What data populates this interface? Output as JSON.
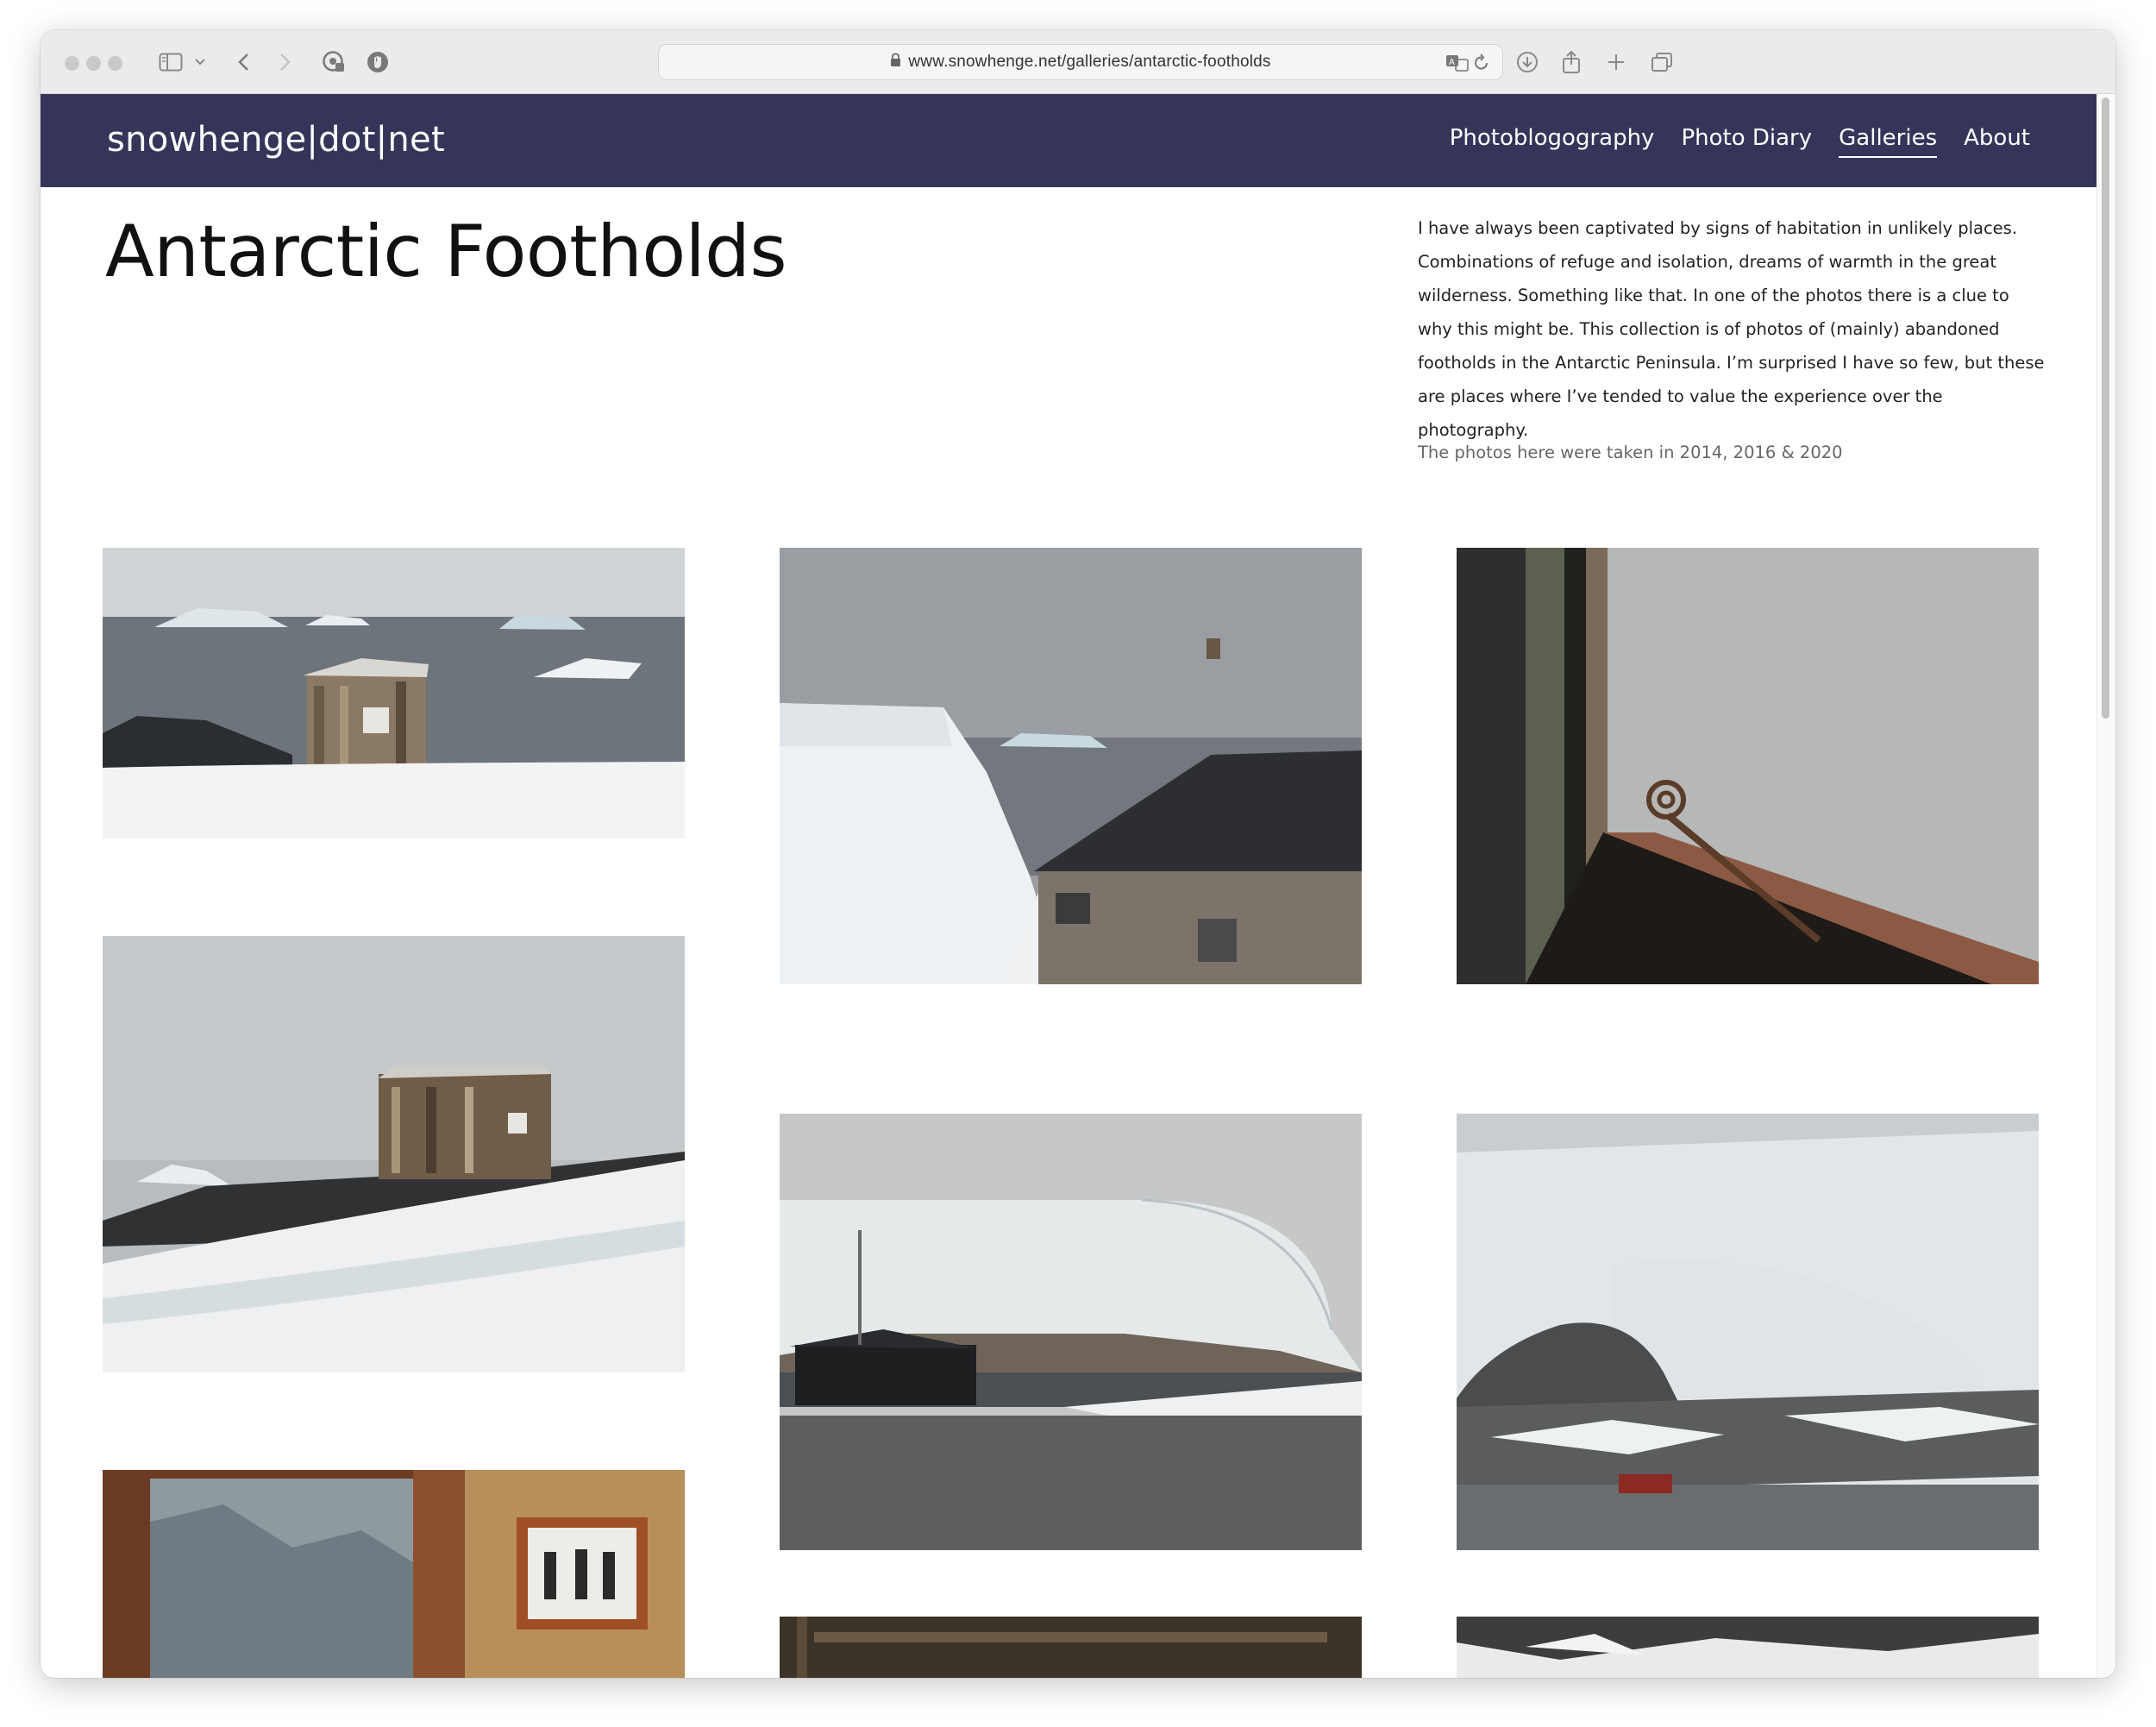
{
  "browser": {
    "url": "www.snowhenge.net/galleries/antarctic-footholds",
    "icons": [
      "sidebar-icon",
      "chevron-down-icon",
      "back-arrow-icon",
      "forward-arrow-icon",
      "privacy-report-icon",
      "extension-icon",
      "lock-icon",
      "translate-icon",
      "reload-icon",
      "download-icon",
      "share-icon",
      "new-tab-icon",
      "tab-overview-icon"
    ]
  },
  "site": {
    "logo": "snowhenge|dot|net",
    "nav": [
      "Photoblogography",
      "Photo Diary",
      "Galleries",
      "About"
    ],
    "active_nav": "Galleries",
    "header_color": "#35355a"
  },
  "gallery": {
    "title": "Antarctic Footholds",
    "intro": "I have always been captivated by signs of habitation in unlikely places. Combinations of refuge and isolation, dreams of warmth in the great wilderness. Something like that.  In one of the photos there is a clue to why this might be. This collection is of photos of (mainly) abandoned footholds in the Antarctic Peninsula.  I’m surprised I have so few, but these are places where I’ve tended to value the experience over the photography.",
    "note": "The photos here were taken in 2014, 2016 & 2020",
    "photos": [
      "Weathered wooden hut on snow with icebergs in the sea",
      "Dark-roofed wooden hut beside a snow bank and icebergs",
      "Rusty window latch against a frosted window pane",
      "Old plank hut on rocks above deep snow",
      "Black hut beneath an ice cliff on a rocky shore",
      "Small red hut below a glacier across the water",
      "Rocky view through a window next to a framed photograph",
      "Rusty window frame",
      "Snowy mountain slope"
    ]
  }
}
